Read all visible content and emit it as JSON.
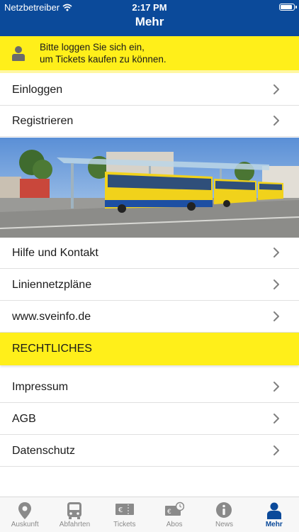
{
  "status_bar": {
    "carrier": "Netzbetreiber",
    "time": "2:17 PM"
  },
  "header": {
    "title": "Mehr"
  },
  "login_banner": {
    "line1": "Bitte loggen Sie sich ein,",
    "line2": "um Tickets kaufen zu können."
  },
  "menu": {
    "login": "Einloggen",
    "register": "Registrieren",
    "help": "Hilfe und Kontakt",
    "network_maps": "Liniennetzpläne",
    "website": "www.sveinfo.de"
  },
  "legal": {
    "title": "RECHTLICHES",
    "imprint": "Impressum",
    "terms": "AGB",
    "privacy": "Datenschutz"
  },
  "tabs": [
    {
      "label": "Auskunft",
      "icon": "location-pin-icon"
    },
    {
      "label": "Abfahrten",
      "icon": "bus-icon"
    },
    {
      "label": "Tickets",
      "icon": "ticket-icon"
    },
    {
      "label": "Abos",
      "icon": "subscription-icon"
    },
    {
      "label": "News",
      "icon": "info-icon"
    },
    {
      "label": "Mehr",
      "icon": "person-icon",
      "active": true
    }
  ],
  "colors": {
    "brand_blue": "#0b4a9a",
    "accent_yellow": "#ffef1a",
    "inactive_gray": "#8a8a8a"
  }
}
